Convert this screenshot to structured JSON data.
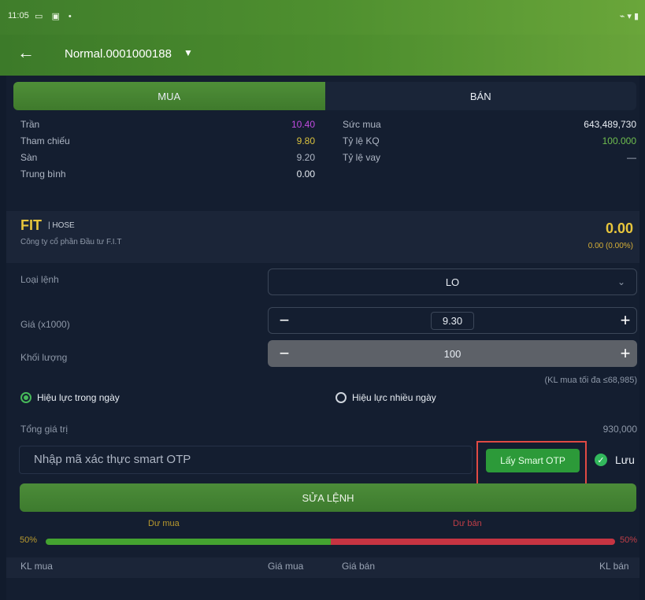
{
  "status": {
    "time": "11:05",
    "left_icons": "▭ ▣ •",
    "right_icons": "⌁ ▾ ▮"
  },
  "appbar": {
    "account": "Normal.0001000188"
  },
  "tabs": {
    "buy": "MUA",
    "sell": "BÁN"
  },
  "info": {
    "left": [
      {
        "label": "Trần",
        "value": "10.40",
        "color": "#c14be0"
      },
      {
        "label": "Tham chiếu",
        "value": "9.80",
        "color": "#d9c13e"
      },
      {
        "label": "Sàn",
        "value": "9.20",
        "color": "#aeb6c4"
      },
      {
        "label": "Trung bình",
        "value": "0.00",
        "color": "#e8edf3"
      }
    ],
    "right": [
      {
        "label": "Sức mua",
        "value": "643,489,730",
        "color": "#e8edf3"
      },
      {
        "label": "Tỷ lệ KQ",
        "value": "100.000",
        "color": "#6fbe4f"
      },
      {
        "label": "Tỷ lệ vay",
        "value": "—",
        "color": "#aeb6c4"
      }
    ]
  },
  "stock": {
    "symbol": "FIT",
    "exchange": "| HOSE",
    "company": "Công ty cổ phần Đầu tư F.I.T",
    "price": "0.00",
    "change": "0.00 (0.00%)"
  },
  "form": {
    "order_type_label": "Loại lệnh",
    "order_type": "LO",
    "price_label": "Giá (x1000)",
    "price": "9.30",
    "volume_label": "Khối lượng",
    "volume": "100",
    "max_note": "(KL mua tối đa ≤68,985)",
    "valid_day": "Hiệu lực trong ngày",
    "valid_multi": "Hiệu lực nhiều ngày",
    "total_label": "Tổng giá trị",
    "total": "930,000",
    "otp_placeholder": "Nhập mã xác thực smart OTP",
    "otp_button": "Lấy Smart OTP",
    "save": "Lưu",
    "submit": "SỬA LỆNH"
  },
  "book": {
    "left_title": "Dư mua",
    "right_title": "Dư bán",
    "left_pct": "50%",
    "right_pct": "50%",
    "buy_share": 0.5,
    "headers": {
      "kl_mua": "KL mua",
      "gia_mua": "Giá mua",
      "gia_ban": "Giá bán",
      "kl_ban": "KL bán"
    }
  }
}
